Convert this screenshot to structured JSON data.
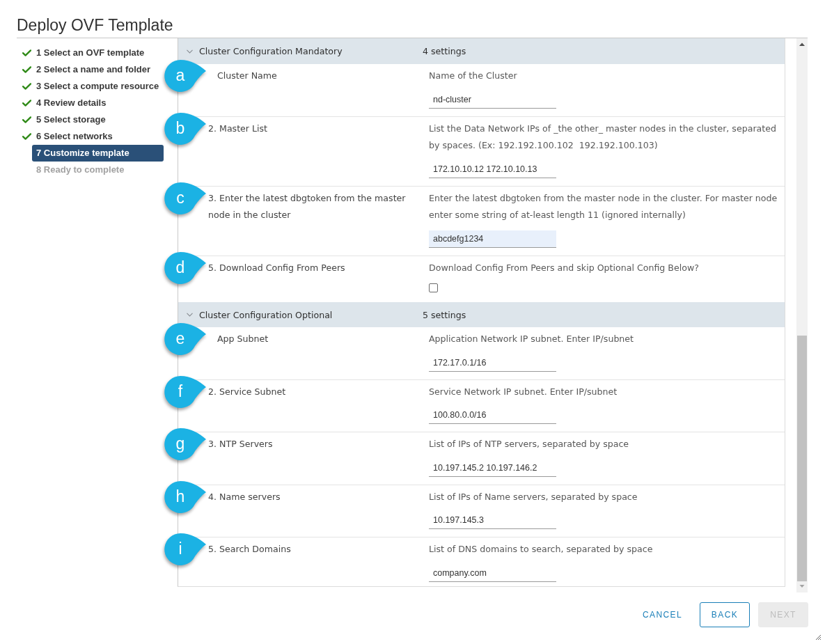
{
  "window": {
    "title": "Deploy OVF Template"
  },
  "steps": [
    {
      "label": "1 Select an OVF template",
      "completed": true,
      "selected": false,
      "disabled": false
    },
    {
      "label": "2 Select a name and folder",
      "completed": true,
      "selected": false,
      "disabled": false
    },
    {
      "label": "3 Select a compute resource",
      "completed": true,
      "selected": false,
      "disabled": false
    },
    {
      "label": "4 Review details",
      "completed": true,
      "selected": false,
      "disabled": false
    },
    {
      "label": "5 Select storage",
      "completed": true,
      "selected": false,
      "disabled": false
    },
    {
      "label": "6 Select networks",
      "completed": true,
      "selected": false,
      "disabled": false
    },
    {
      "label": "7 Customize template",
      "completed": false,
      "selected": true,
      "disabled": false
    },
    {
      "label": "8 Ready to complete",
      "completed": false,
      "selected": false,
      "disabled": true
    }
  ],
  "sections": [
    {
      "title": "Cluster Configuration Mandatory",
      "count": "4 settings",
      "expanded": true,
      "fields": [
        {
          "callout": "a",
          "label": "Cluster Name",
          "description": "Name of the Cluster",
          "kind": "text",
          "value": "nd-cluster",
          "focused": false
        },
        {
          "callout": "b",
          "number": "2.",
          "label": "Master List",
          "description": "List the Data Network IPs of _the other_ master nodes in the cluster, separated by spaces. (Ex: 192.192.100.102  192.192.100.103)",
          "kind": "text",
          "value": "172.10.10.12 172.10.10.13",
          "focused": false
        },
        {
          "callout": "c",
          "number": "3.",
          "label": "Enter the latest dbgtoken from the master node in the cluster",
          "description": "Enter the latest dbgtoken from the master node in the cluster. For master node enter some string of at-least length 11 (ignored internally)",
          "kind": "text",
          "value": "abcdefg1234",
          "focused": true
        },
        {
          "callout": "d",
          "number": "5.",
          "label": "Download Config From Peers",
          "description": "Download Config From Peers and skip Optional Config Below?",
          "kind": "checkbox",
          "checked": false
        }
      ]
    },
    {
      "title": "Cluster Configuration Optional",
      "count": "5 settings",
      "expanded": true,
      "fields": [
        {
          "callout": "e",
          "label": "App Subnet",
          "description": "Application Network IP subnet. Enter IP/subnet",
          "kind": "text",
          "value": "172.17.0.1/16",
          "focused": false
        },
        {
          "callout": "f",
          "number": "2.",
          "label": "Service Subnet",
          "description": "Service Network IP subnet. Enter IP/subnet",
          "kind": "text",
          "value": "100.80.0.0/16",
          "focused": false
        },
        {
          "callout": "g",
          "number": "3.",
          "label": "NTP Servers",
          "description": "List of IPs of NTP servers, separated by space",
          "kind": "text",
          "value": "10.197.145.2 10.197.146.2",
          "focused": false
        },
        {
          "callout": "h",
          "number": "4.",
          "label": "Name servers",
          "description": "List of IPs of Name servers, separated by space",
          "kind": "text",
          "value": "10.197.145.3",
          "focused": false
        },
        {
          "callout": "i",
          "number": "5.",
          "label": "Search Domains",
          "description": "List of DNS domains to search, separated by space",
          "kind": "text",
          "value": "company.com",
          "focused": false
        }
      ]
    }
  ],
  "buttons": [
    {
      "label": "CANCEL",
      "kind": "link",
      "disabled": false
    },
    {
      "label": "BACK",
      "kind": "outline",
      "disabled": false
    },
    {
      "label": "NEXT",
      "kind": "primary",
      "disabled": true
    }
  ]
}
